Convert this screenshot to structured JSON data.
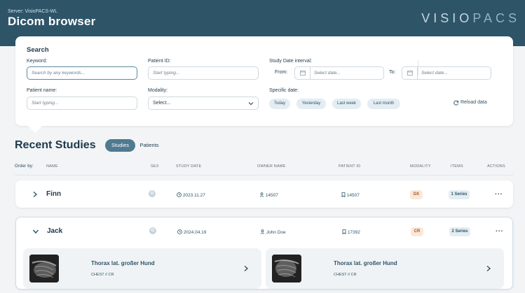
{
  "header": {
    "server": "Server: VisioPACS-WL",
    "title": "Dicom browser",
    "logo_part1": "VISIO",
    "logo_part2": "PACS"
  },
  "search": {
    "title": "Search",
    "keyword_label": "Keyword:",
    "keyword_placeholder": "Search by any keywords...",
    "patient_id_label": "Patient ID:",
    "patient_id_placeholder": "Start typing...",
    "study_date_label": "Study Date interval:",
    "from_label": "From:",
    "from_placeholder": "Select date...",
    "to_label": "To:",
    "to_placeholder": "Select date...",
    "patient_name_label": "Patient name:",
    "patient_name_placeholder": "Start typing...",
    "modality_label": "Modality:",
    "modality_value": "Select...",
    "specific_date_label": "Specific date:",
    "chips": [
      "Today",
      "Yesterday",
      "Last week",
      "Last month"
    ],
    "reload_label": "Reload data"
  },
  "recent": {
    "title": "Recent Studies",
    "tab_studies": "Studies",
    "tab_patients": "Patients",
    "order_by": "Order by:",
    "columns": {
      "name": "NAME",
      "sex": "SEX",
      "study_date": "STUDY DATE",
      "owner_name": "OWNER NAME",
      "patient_id": "PATIENT ID",
      "modality": "MODALITY",
      "items": "ITEMS",
      "actions": "ACTIONS"
    }
  },
  "studies": [
    {
      "name": "Finn",
      "sex": "O",
      "date": "2023.11.27",
      "owner": "14507",
      "patient_id": "14507",
      "modality": "DX",
      "items": "1 Series",
      "actions": "..."
    },
    {
      "name": "Jack",
      "sex": "O",
      "date": "2024.04.19",
      "owner": "John Doe",
      "patient_id": "17392",
      "modality": "CR",
      "items": "2 Series",
      "actions": "..."
    }
  ],
  "series": [
    {
      "title": "Thorax lat. großer Hund",
      "sub": "CHEST // CR"
    },
    {
      "title": "Thorax lat. großer Hund",
      "sub": "CHEST // CR"
    }
  ],
  "colors": {
    "header_bg": "#2e5468",
    "accent": "#4f7a90",
    "modality_badge_bg": "#fbe8d9",
    "items_badge_bg": "#e3edf2"
  }
}
